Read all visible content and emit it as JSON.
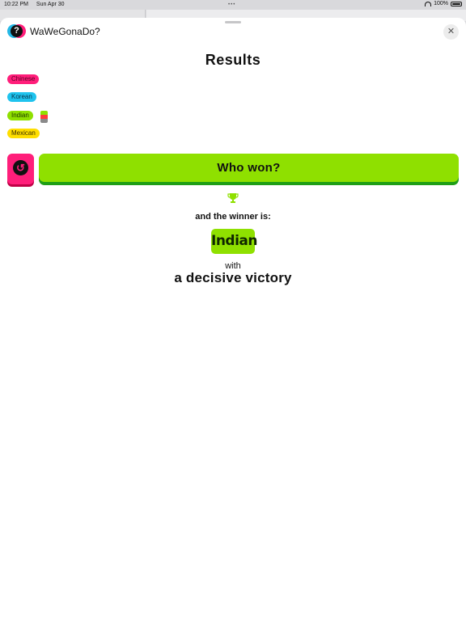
{
  "status_bar": {
    "time": "10:22 PM",
    "date": "Sun Apr 30",
    "battery": "100%"
  },
  "app": {
    "title": "WaWeGonaDo?",
    "logo_glyph": "?",
    "close_glyph": "✕"
  },
  "results": {
    "title": "Results",
    "options": [
      {
        "label": "Chinese",
        "color": "#ff1e7a",
        "votes": 0
      },
      {
        "label": "Korean",
        "color": "#1fc3ee",
        "votes": 0
      },
      {
        "label": "Indian",
        "color": "#8fe000",
        "votes": 1
      },
      {
        "label": "Mexican",
        "color": "#ffde00",
        "votes": 0
      }
    ],
    "vote_stack_colors": [
      "#8fe000",
      "#ff3b3b",
      "#8a8a8a"
    ]
  },
  "actions": {
    "undo_icon": "undo-arrow-icon",
    "who_won_label": "Who won?"
  },
  "winner": {
    "trophy_icon": "trophy-icon",
    "intro": "and the winner is:",
    "name": "Indian",
    "with": "with",
    "margin": "a decisive victory"
  }
}
